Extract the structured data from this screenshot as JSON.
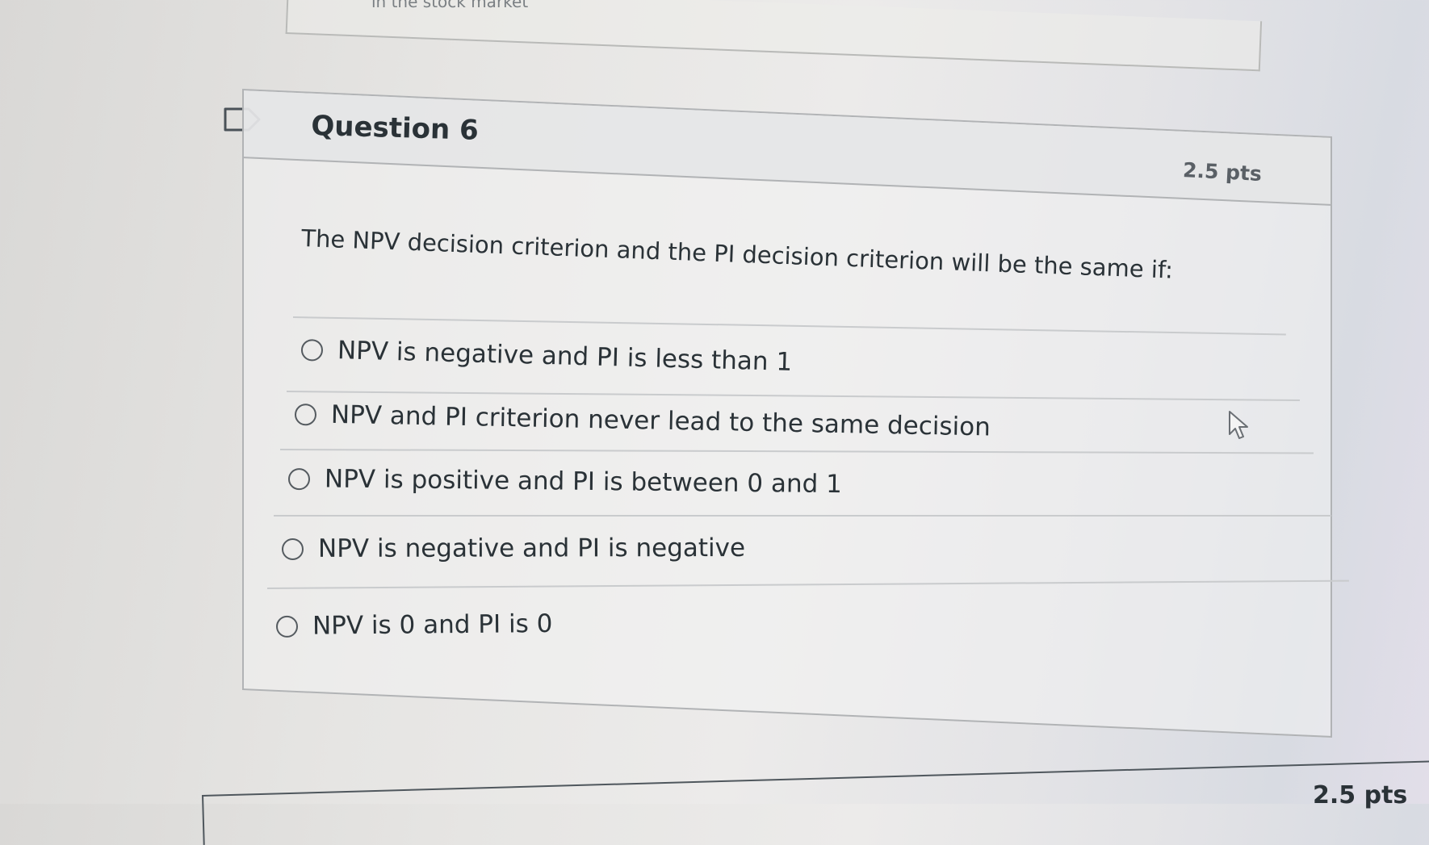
{
  "previous_question": {
    "partial_text": "in the stock market"
  },
  "question": {
    "title": "Question 6",
    "points": "2.5 pts",
    "text": "The NPV decision criterion and the PI decision criterion will be the same if:",
    "answers": [
      {
        "label": "NPV is negative and PI is less than 1",
        "selected": false
      },
      {
        "label": "NPV and PI criterion never lead to the same decision",
        "selected": false
      },
      {
        "label": "NPV is positive and PI is between 0 and 1",
        "selected": false
      },
      {
        "label": "NPV is negative and PI is negative",
        "selected": false
      },
      {
        "label": "NPV is 0 and PI is 0",
        "selected": false
      }
    ]
  },
  "next_question": {
    "points": "2.5 pts"
  },
  "icons": {
    "flag": "flag-icon",
    "cursor": "mouse-pointer-icon"
  },
  "colors": {
    "text": "#2a3237",
    "border": "#b1b3b5",
    "header_bg": "#e4e5e6"
  }
}
